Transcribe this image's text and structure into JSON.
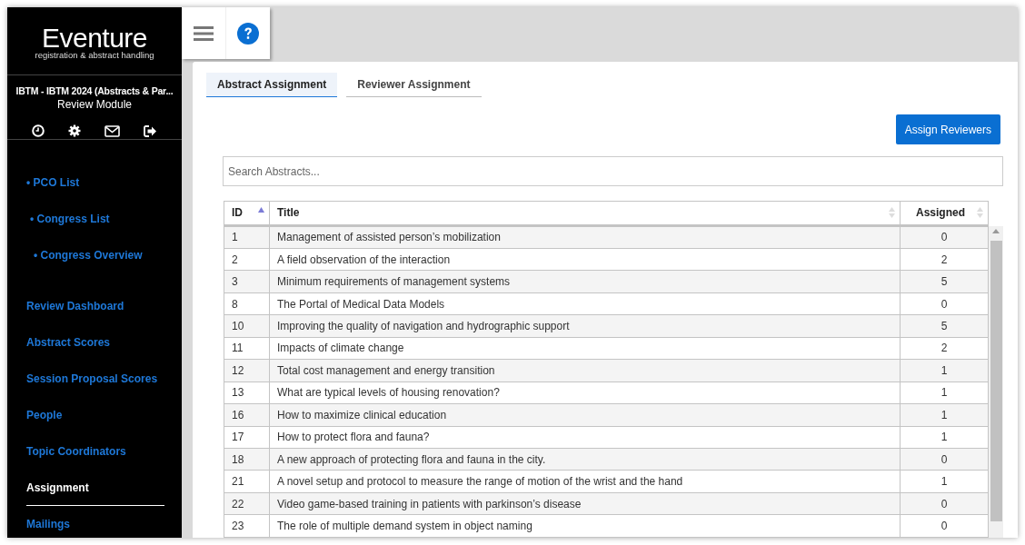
{
  "brand": {
    "name": "Eventure",
    "tagline": "registration & abstract handling"
  },
  "congress": {
    "title": "IBTM - IBTM 2024 (Abstracts & Par...",
    "module": "Review Module"
  },
  "sidebar": {
    "items": [
      {
        "label": "• PCO List",
        "selected": false,
        "children": [
          {
            "label": "• Congress List",
            "selected": false,
            "children": [
              {
                "label": "• Congress Overview",
                "selected": false
              }
            ]
          }
        ]
      },
      {
        "label": "Review Dashboard",
        "selected": false
      },
      {
        "label": "Abstract Scores",
        "selected": false
      },
      {
        "label": "Session Proposal Scores",
        "selected": false
      },
      {
        "label": "People",
        "selected": false
      },
      {
        "label": "Topic Coordinators",
        "selected": false
      },
      {
        "label": "Assignment",
        "selected": true
      },
      {
        "label": "Mailings",
        "selected": false
      }
    ]
  },
  "tabs": [
    {
      "label": "Abstract Assignment",
      "selected": true
    },
    {
      "label": "Reviewer Assignment",
      "selected": false
    }
  ],
  "assign_button": "Assign Reviewers",
  "search": {
    "placeholder": "Search Abstracts..."
  },
  "table": {
    "columns": [
      {
        "label": "ID",
        "sorted": true
      },
      {
        "label": "Title",
        "sorted": false
      },
      {
        "label": "Assigned",
        "sorted": false
      }
    ],
    "rows": [
      [
        "1",
        "Management of assisted person’s mobilization",
        "0"
      ],
      [
        "2",
        "A field observation of the interaction",
        "2"
      ],
      [
        "3",
        "Minimum requirements of management systems",
        "5"
      ],
      [
        "8",
        "The Portal of Medical Data Models",
        "0"
      ],
      [
        "10",
        "Improving the quality of navigation and hydrographic support",
        "5"
      ],
      [
        "11",
        "Impacts of climate change",
        "2"
      ],
      [
        "12",
        "Total cost management and energy transition",
        "1"
      ],
      [
        "13",
        "What are typical levels of housing renovation?",
        "1"
      ],
      [
        "16",
        "How to maximize clinical education",
        "1"
      ],
      [
        "17",
        "How to protect flora and fauna?",
        "1"
      ],
      [
        "18",
        "A new approach of protecting flora and fauna in the city.",
        "0"
      ],
      [
        "21",
        "A novel setup and protocol to measure the range of motion of the wrist and the hand",
        "1"
      ],
      [
        "22",
        "Video game-based training in patients with parkinson’s disease",
        "0"
      ],
      [
        "23",
        "The role of multiple demand system in object naming",
        "0"
      ]
    ]
  }
}
